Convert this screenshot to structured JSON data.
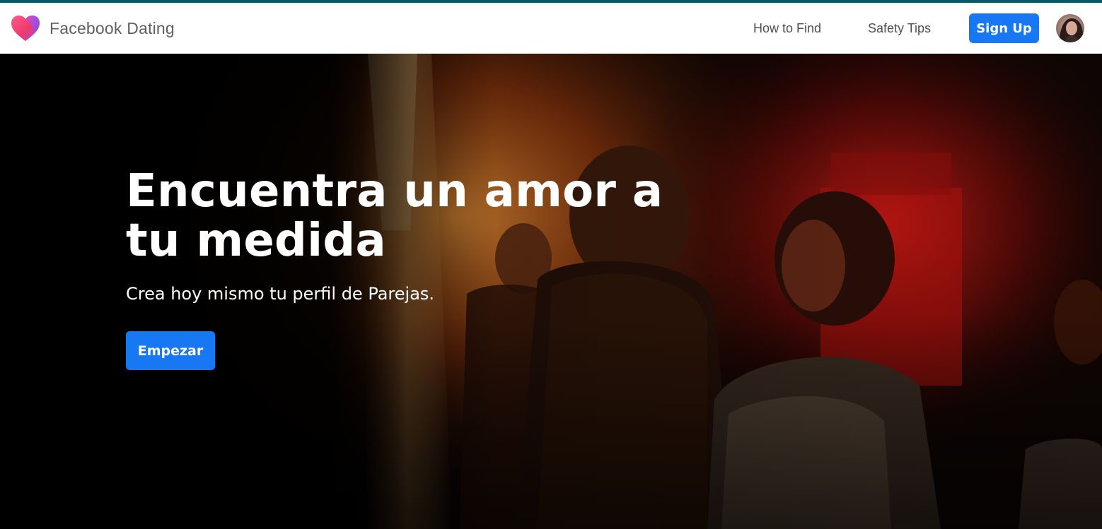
{
  "nav": {
    "brand": "Facebook Dating",
    "links": [
      "How to Find",
      "Safety Tips"
    ],
    "signup_label": "Sign Up",
    "accent_color": "#1877f2",
    "logo_icon": "heart-icon",
    "avatar_icon": "user-avatar"
  },
  "hero": {
    "title": "Encuentra un amor a tu medida",
    "subtitle": "Crea hoy mismo tu perfil de Parejas.",
    "cta_label": "Empezar",
    "background": "photo of couple dancing in dim red and orange lit club"
  }
}
